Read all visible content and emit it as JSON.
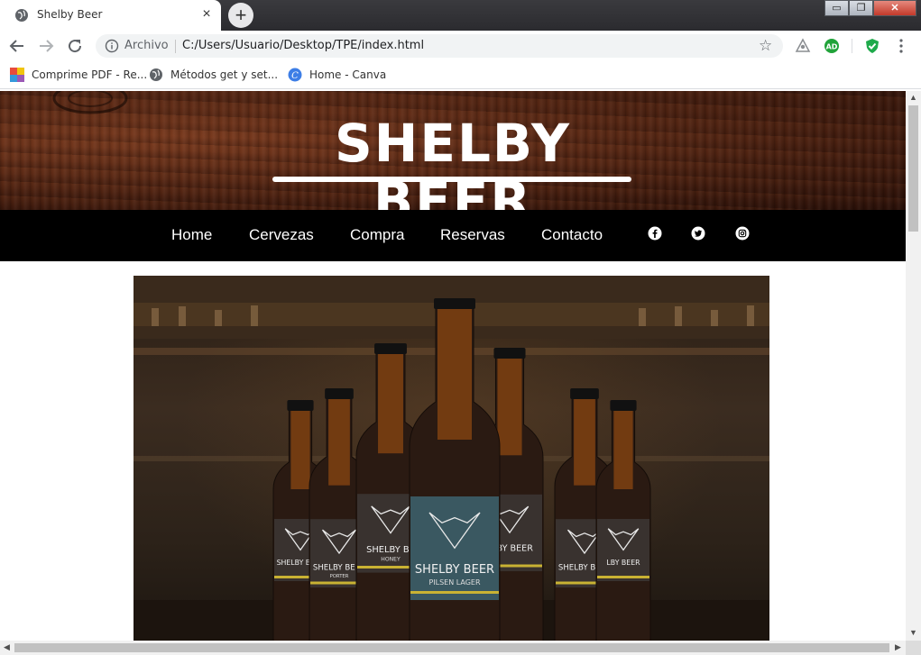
{
  "browser": {
    "tab": {
      "title": "Shelby Beer",
      "close_icon": "×"
    },
    "new_tab_icon": "+",
    "window_controls": {
      "minimize": "▭",
      "maximize": "❐",
      "close": "✕"
    },
    "address": {
      "scheme_label": "Archivo",
      "url": "C:/Users/Usuario/Desktop/TPE/index.html",
      "star_icon": "☆"
    },
    "bookmarks": [
      {
        "label": "Comprime PDF - Re...",
        "icon": "colorful-grid-icon"
      },
      {
        "label": "Métodos get y set...",
        "icon": "globe-icon"
      },
      {
        "label": "Home - Canva",
        "icon": "canva-icon"
      }
    ]
  },
  "site": {
    "logo_text": "SHELBY BEER",
    "nav": [
      "Home",
      "Cervezas",
      "Compra",
      "Reservas",
      "Contacto"
    ],
    "social": [
      "facebook-icon",
      "twitter-icon",
      "instagram-icon"
    ],
    "hero": {
      "alt": "bottles-image",
      "bottles": [
        {
          "label": "SHELBY BEER",
          "sublabel": ""
        },
        {
          "label": "SHELBY BEER",
          "sublabel": "PORTER"
        },
        {
          "label": "SHELBY BE",
          "sublabel": "HONEY"
        },
        {
          "label": "SHELBY BEER",
          "sublabel": "PILSEN LAGER"
        },
        {
          "label": "ELBY BEER",
          "sublabel": ""
        },
        {
          "label": "SHELBY BEER",
          "sublabel": ""
        },
        {
          "label": "LBY BEER",
          "sublabel": ""
        }
      ]
    }
  },
  "colors": {
    "nav_bg": "#000000",
    "tab_bg": "#ffffff",
    "wood": "#4a2010",
    "label_accent": "#c9b233",
    "beer": "#7a3f12"
  }
}
